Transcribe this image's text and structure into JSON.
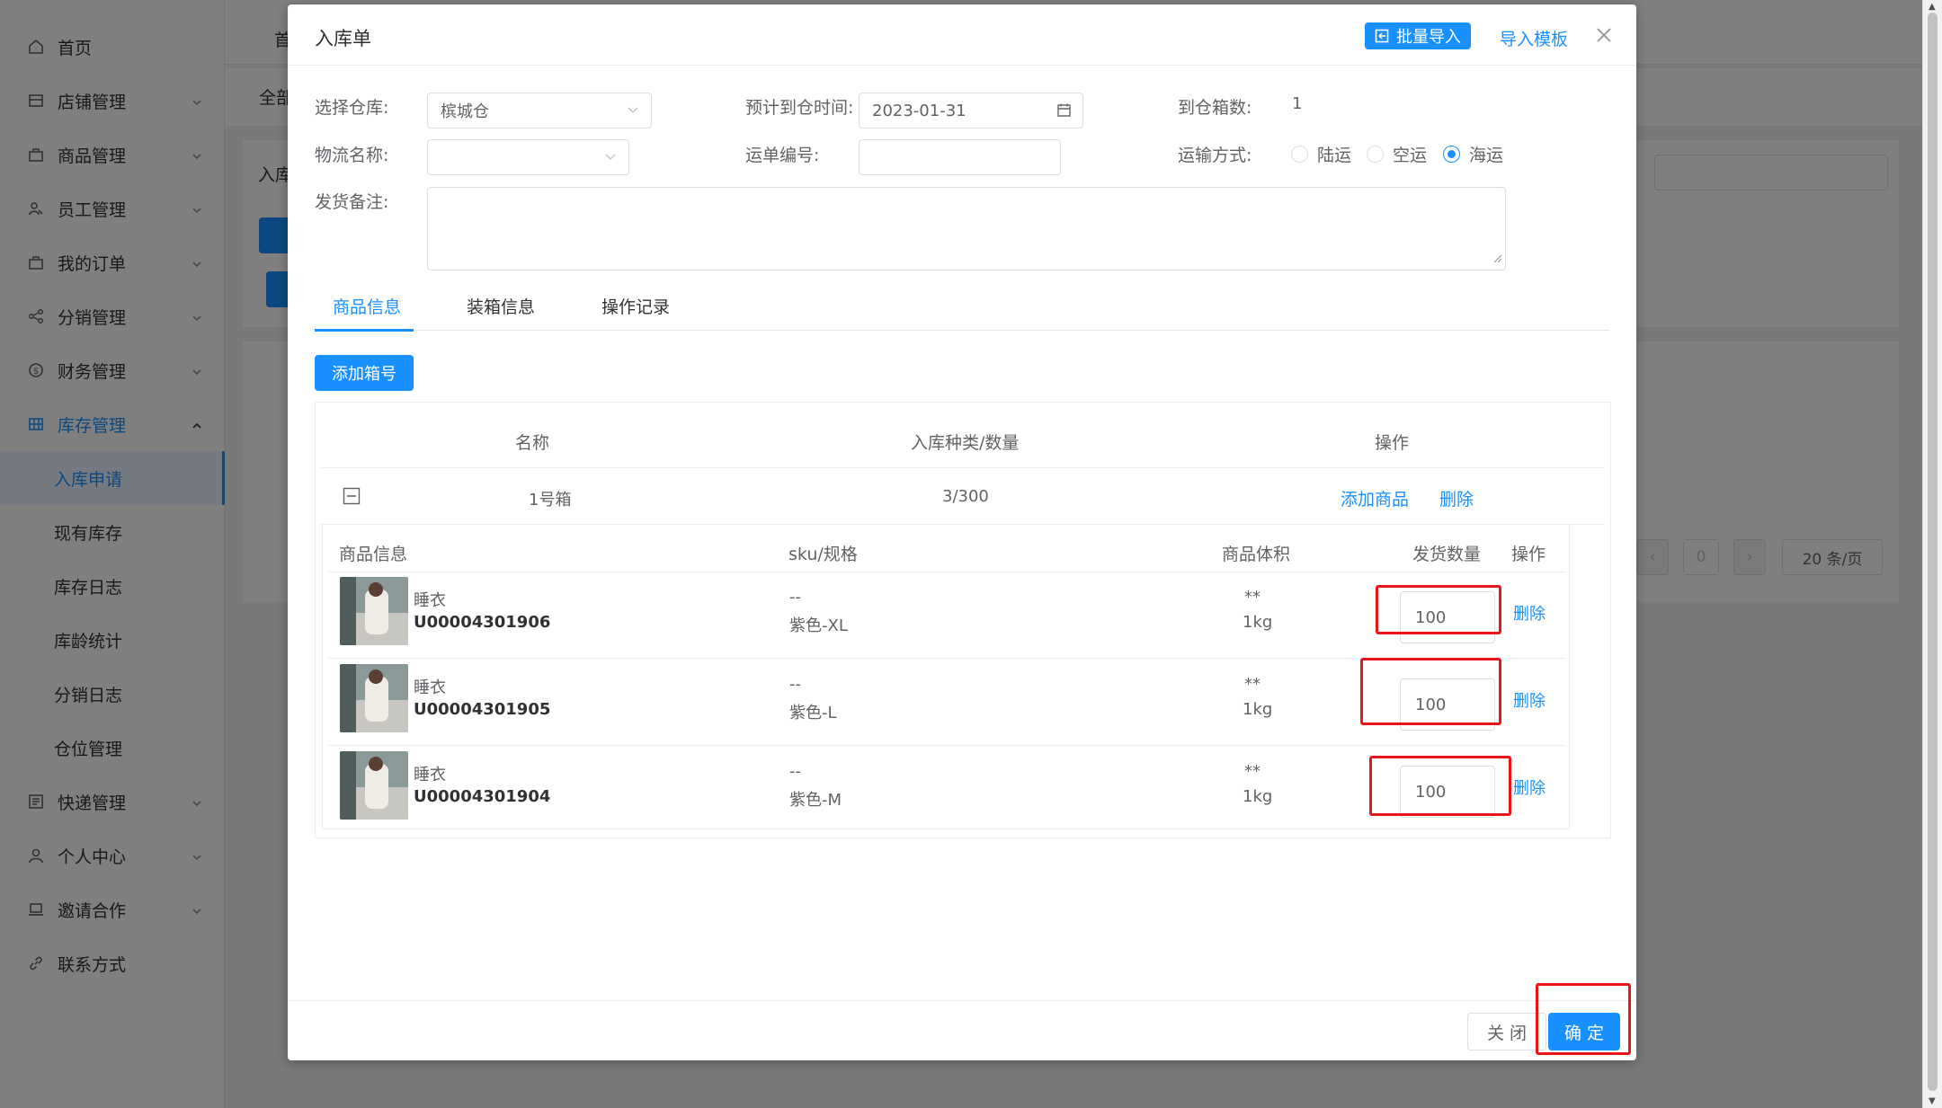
{
  "sidebar": {
    "items": [
      {
        "label": "首页",
        "icon": "home-icon"
      },
      {
        "label": "店铺管理",
        "icon": "store-icon"
      },
      {
        "label": "商品管理",
        "icon": "goods-icon"
      },
      {
        "label": "员工管理",
        "icon": "staff-icon"
      },
      {
        "label": "我的订单",
        "icon": "order-icon"
      },
      {
        "label": "分销管理",
        "icon": "share-icon"
      },
      {
        "label": "财务管理",
        "icon": "finance-icon"
      },
      {
        "label": "库存管理",
        "icon": "grid-icon"
      },
      {
        "label": "快递管理",
        "icon": "express-icon"
      },
      {
        "label": "个人中心",
        "icon": "user-icon"
      },
      {
        "label": "邀请合作",
        "icon": "laptop-icon"
      },
      {
        "label": "联系方式",
        "icon": "link-icon"
      }
    ],
    "sub_items": [
      "入库申请",
      "现有库存",
      "库存日志",
      "库龄统计",
      "分销日志",
      "仓位管理"
    ]
  },
  "background": {
    "tab1": "首",
    "tab2": "全部",
    "card_label": "入库",
    "pager_page": "0",
    "page_size": "20 条/页"
  },
  "dialog": {
    "title": "入库单",
    "batch_import_label": "批量导入",
    "import_template_label": "导入模板",
    "form": {
      "warehouse_label": "选择仓库:",
      "warehouse_value": "槟城仓",
      "eta_label": "预计到仓时间:",
      "eta_value": "2023-01-31",
      "boxes_label": "到仓箱数:",
      "boxes_value": "1",
      "logistics_label": "物流名称:",
      "logistics_value": "",
      "waybill_label": "运单编号:",
      "waybill_value": "",
      "transport_label": "运输方式:",
      "transport_options": [
        "陆运",
        "空运",
        "海运"
      ],
      "transport_selected": "海运",
      "remark_label": "发货备注:",
      "remark_value": ""
    },
    "tabs": [
      "商品信息",
      "装箱信息",
      "操作记录"
    ],
    "add_box_label": "添加箱号",
    "outer_table": {
      "headers": [
        "名称",
        "入库种类/数量",
        "操作"
      ],
      "row": {
        "name": "1号箱",
        "count": "3/300",
        "add_goods": "添加商品",
        "delete": "删除"
      }
    },
    "inner_table": {
      "headers": [
        "商品信息",
        "sku/规格",
        "商品体积",
        "发货数量",
        "操作"
      ],
      "rows": [
        {
          "name": "睡衣",
          "sku": "U00004301906",
          "spec_dash": "--",
          "spec": "紫色-XL",
          "volume": "**",
          "weight": "1kg",
          "qty": "100",
          "action": "删除"
        },
        {
          "name": "睡衣",
          "sku": "U00004301905",
          "spec_dash": "--",
          "spec": "紫色-L",
          "volume": "**",
          "weight": "1kg",
          "qty": "100",
          "action": "删除"
        },
        {
          "name": "睡衣",
          "sku": "U00004301904",
          "spec_dash": "--",
          "spec": "紫色-M",
          "volume": "**",
          "weight": "1kg",
          "qty": "100",
          "action": "删除"
        }
      ]
    },
    "footer": {
      "close_label": "关 闭",
      "confirm_label": "确 定"
    }
  },
  "colors": {
    "primary": "#1890ff",
    "highlight": "#e8161b",
    "overlay": "rgba(0,0,0,0.5)"
  }
}
